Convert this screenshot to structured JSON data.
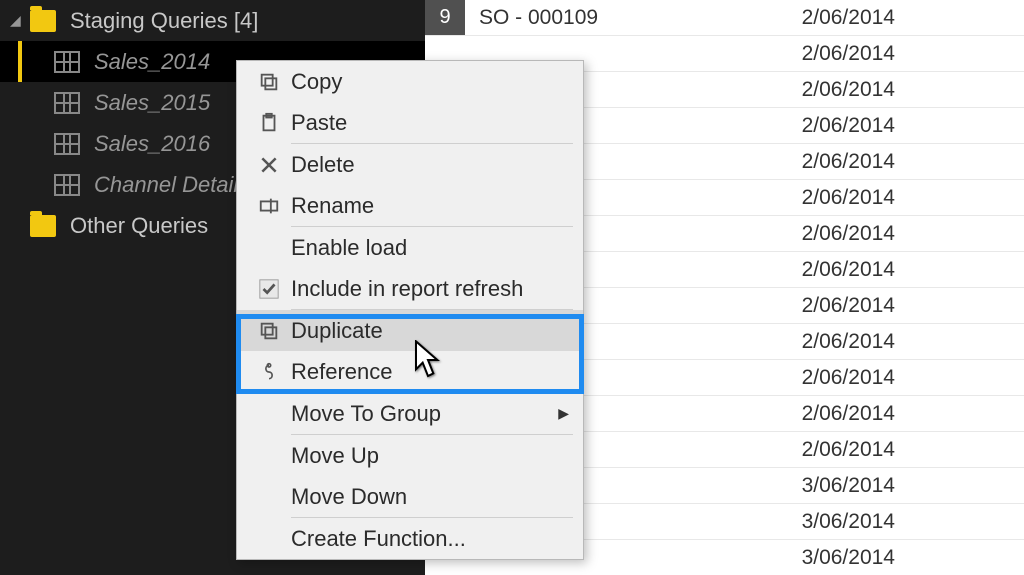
{
  "sidebar": {
    "groups": [
      {
        "label": "Staging Queries [4]",
        "queries": [
          {
            "label": "Sales_2014",
            "selected": true
          },
          {
            "label": "Sales_2015",
            "selected": false
          },
          {
            "label": "Sales_2016",
            "selected": false
          },
          {
            "label": "Channel Details",
            "selected": false
          }
        ]
      },
      {
        "label": "Other Queries",
        "queries": []
      }
    ]
  },
  "table": {
    "rows": [
      {
        "num": "9",
        "a": "SO - 000109",
        "b": "2/06/2014"
      },
      {
        "num": "",
        "a": "",
        "b": "2/06/2014"
      },
      {
        "num": "",
        "a": "",
        "b": "2/06/2014"
      },
      {
        "num": "",
        "a": "",
        "b": "2/06/2014"
      },
      {
        "num": "",
        "a": "",
        "b": "2/06/2014"
      },
      {
        "num": "",
        "a": "",
        "b": "2/06/2014"
      },
      {
        "num": "",
        "a": "",
        "b": "2/06/2014"
      },
      {
        "num": "",
        "a": "",
        "b": "2/06/2014"
      },
      {
        "num": "",
        "a": "",
        "b": "2/06/2014"
      },
      {
        "num": "",
        "a": "",
        "b": "2/06/2014"
      },
      {
        "num": "",
        "a": "",
        "b": "2/06/2014"
      },
      {
        "num": "",
        "a": "",
        "b": "2/06/2014"
      },
      {
        "num": "",
        "a": "",
        "b": "2/06/2014"
      },
      {
        "num": "",
        "a": "",
        "b": "3/06/2014"
      },
      {
        "num": "",
        "a": "",
        "b": "3/06/2014"
      },
      {
        "num": "",
        "a": "",
        "b": "3/06/2014"
      }
    ]
  },
  "context_menu": {
    "items": [
      {
        "label": "Copy",
        "icon": "copy-icon",
        "sep_after": false
      },
      {
        "label": "Paste",
        "icon": "paste-icon",
        "sep_after": true
      },
      {
        "label": "Delete",
        "icon": "delete-icon",
        "sep_after": false
      },
      {
        "label": "Rename",
        "icon": "rename-icon",
        "sep_after": true
      },
      {
        "label": "Enable load",
        "icon": "",
        "sep_after": false
      },
      {
        "label": "Include in report refresh",
        "icon": "check-icon",
        "sep_after": true
      },
      {
        "label": "Duplicate",
        "icon": "duplicate-icon",
        "sep_after": false,
        "hover": true
      },
      {
        "label": "Reference",
        "icon": "reference-icon",
        "sep_after": true
      },
      {
        "label": "Move To Group",
        "icon": "",
        "sep_after": true,
        "submenu": true
      },
      {
        "label": "Move Up",
        "icon": "",
        "sep_after": false
      },
      {
        "label": "Move Down",
        "icon": "",
        "sep_after": true
      },
      {
        "label": "Create Function...",
        "icon": "",
        "sep_after": false
      }
    ]
  }
}
